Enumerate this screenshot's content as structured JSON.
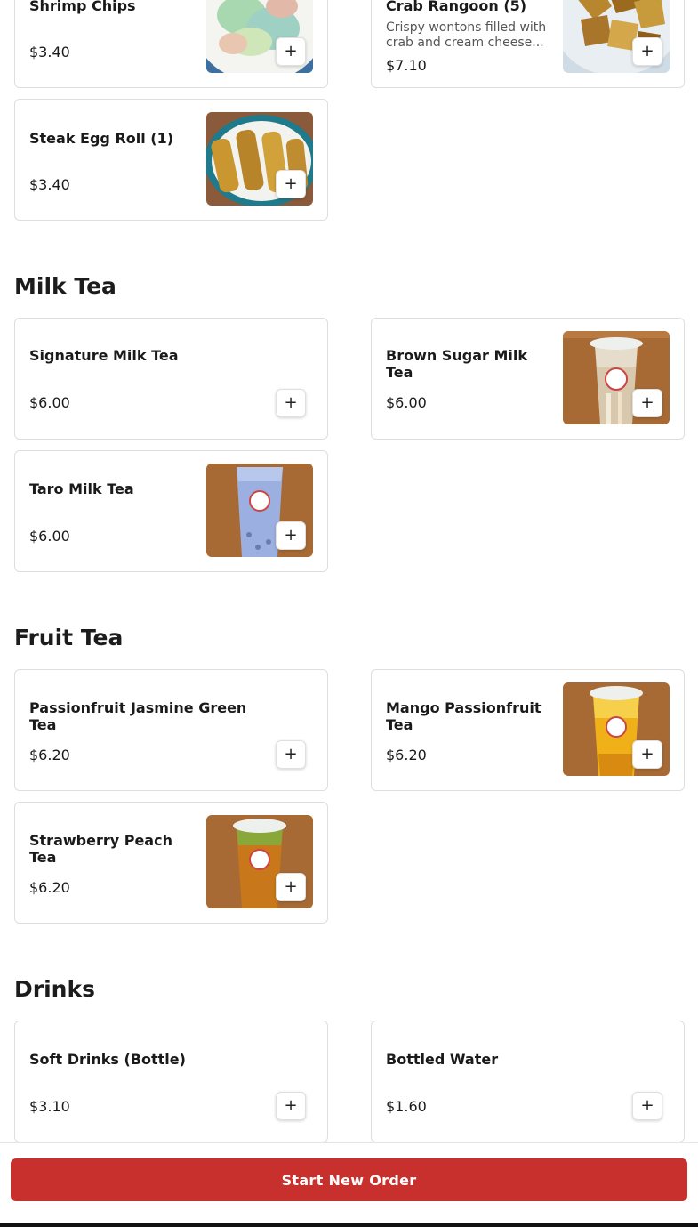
{
  "sections": {
    "milk_tea": "Milk Tea",
    "fruit_tea": "Fruit Tea",
    "drinks": "Drinks"
  },
  "items": {
    "shrimp_chips": {
      "name": "Shrimp Chips",
      "price": "$3.40",
      "image": "shrimp-chips-photo"
    },
    "crab_rangoon": {
      "name": "Crab Rangoon (5)",
      "description": "Crispy wontons filled with crab and cream cheese...",
      "price": "$7.10",
      "image": "crab-rangoon-photo"
    },
    "steak_egg_roll": {
      "name": "Steak Egg Roll (1)",
      "price": "$3.40",
      "image": "egg-roll-photo"
    },
    "signature_milk_tea": {
      "name": "Signature Milk Tea",
      "price": "$6.00"
    },
    "brown_sugar_milk_tea": {
      "name": "Brown Sugar Milk Tea",
      "price": "$6.00",
      "image": "brown-sugar-milk-tea-photo"
    },
    "taro_milk_tea": {
      "name": "Taro Milk Tea",
      "price": "$6.00",
      "image": "taro-milk-tea-photo"
    },
    "passionfruit_jasmine": {
      "name": "Passionfruit Jasmine Green Tea",
      "price": "$6.20"
    },
    "mango_passionfruit": {
      "name": "Mango Passionfruit Tea",
      "price": "$6.20",
      "image": "mango-passionfruit-tea-photo"
    },
    "strawberry_peach": {
      "name": "Strawberry Peach Tea",
      "price": "$6.20",
      "image": "strawberry-peach-tea-photo"
    },
    "soft_drinks": {
      "name": "Soft Drinks (Bottle)",
      "price": "$3.10"
    },
    "bottled_water": {
      "name": "Bottled Water",
      "price": "$1.60"
    }
  },
  "add_button_label": "+",
  "footer": {
    "start_order_label": "Start New Order"
  },
  "colors": {
    "brand_red": "#c8302d",
    "card_border": "#dedede"
  }
}
